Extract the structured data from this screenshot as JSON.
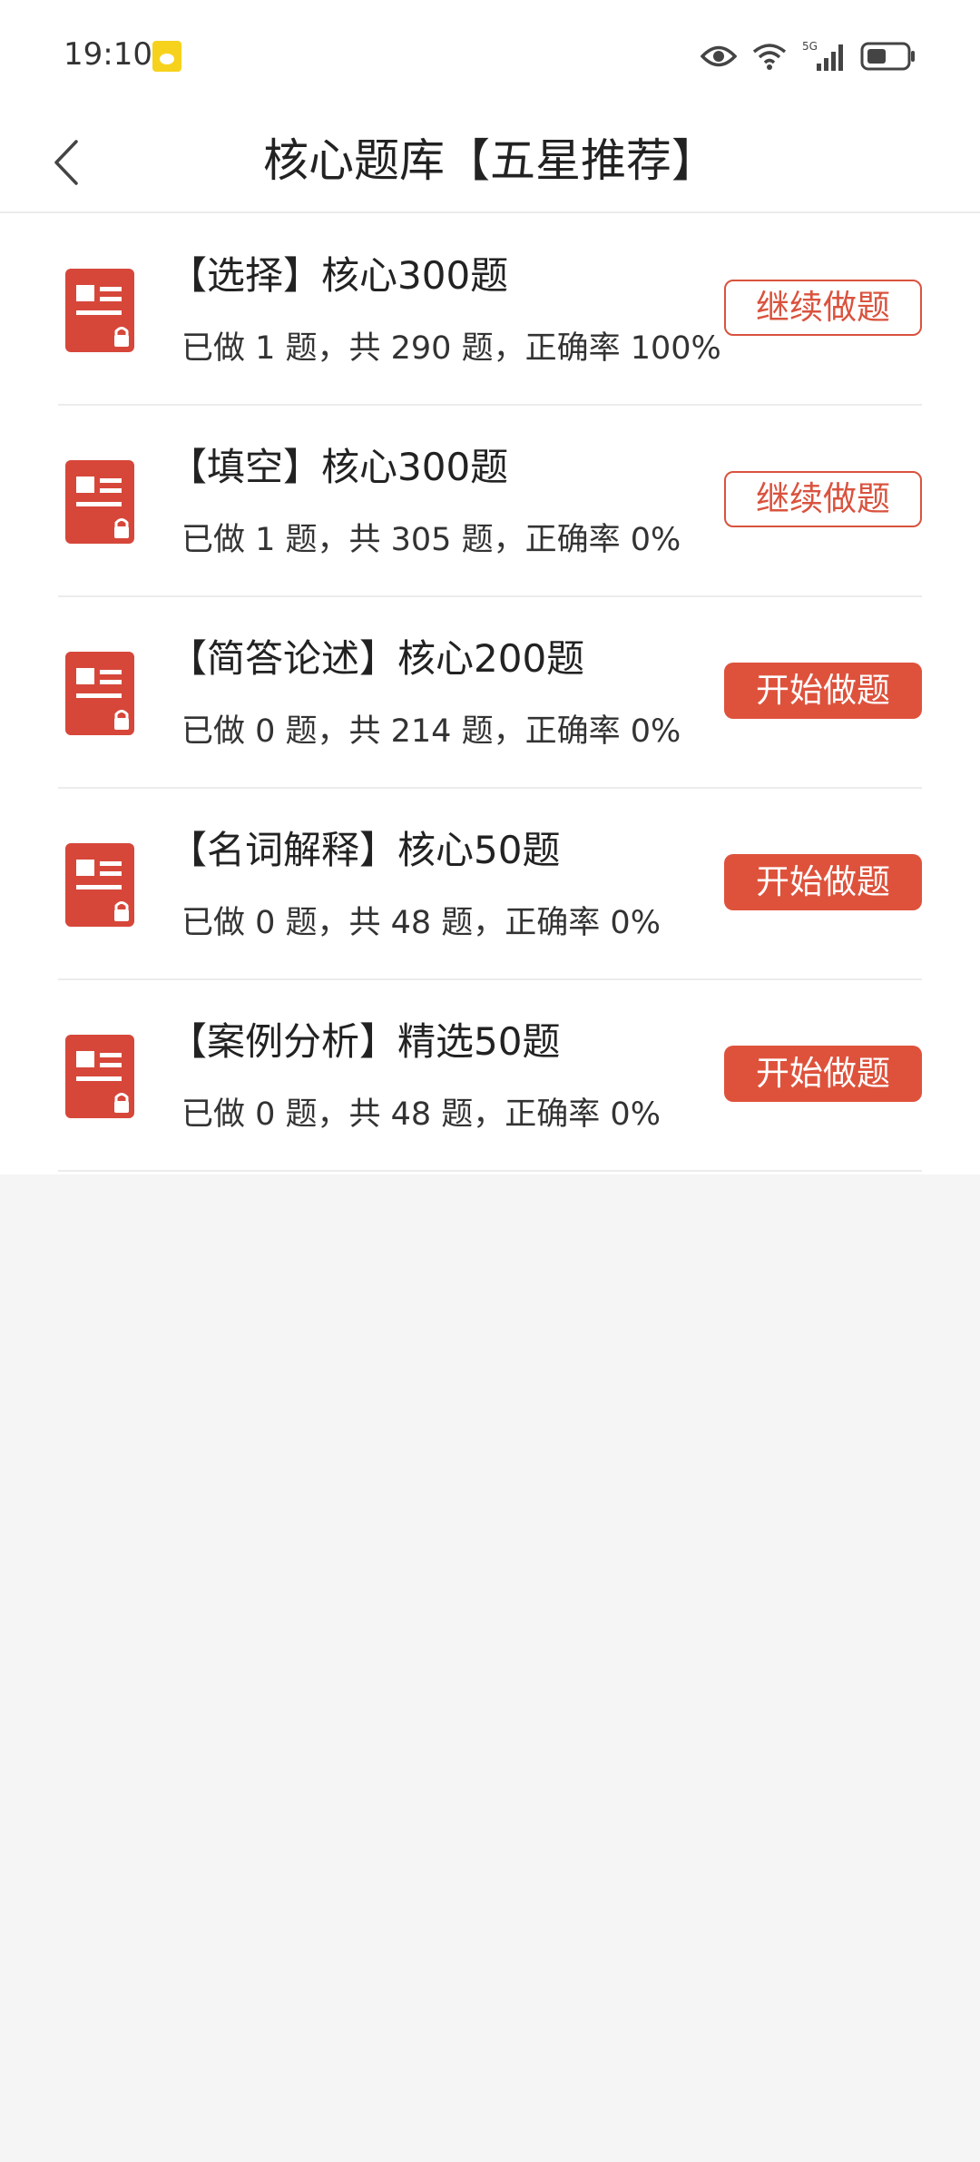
{
  "status_bar": {
    "time": "19:10",
    "icons": [
      "app-notification-icon",
      "eye-icon",
      "wifi-icon",
      "signal-5g-icon",
      "battery-icon"
    ],
    "network_label": "5G"
  },
  "header": {
    "title": "核心题库【五星推荐】",
    "back_icon": "chevron-left-icon"
  },
  "colors": {
    "accent": "#de523c",
    "icon_red": "#d6473a",
    "background": "#f5f5f5",
    "divider": "#ececec"
  },
  "items": [
    {
      "title": "【选择】核心300题",
      "stats": "已做 1 题，共 290 题，正确率 100%",
      "button": "继续做题",
      "button_style": "outline"
    },
    {
      "title": "【填空】核心300题",
      "stats": "已做 1 题，共 305 题，正确率 0%",
      "button": "继续做题",
      "button_style": "outline"
    },
    {
      "title": "【简答论述】核心200题",
      "stats": "已做 0 题，共 214 题，正确率 0%",
      "button": "开始做题",
      "button_style": "solid"
    },
    {
      "title": "【名词解释】核心50题",
      "stats": "已做 0 题，共 48 题，正确率 0%",
      "button": "开始做题",
      "button_style": "solid"
    },
    {
      "title": "【案例分析】精选50题",
      "stats": "已做 0 题，共 48 题，正确率 0%",
      "button": "开始做题",
      "button_style": "solid"
    }
  ]
}
